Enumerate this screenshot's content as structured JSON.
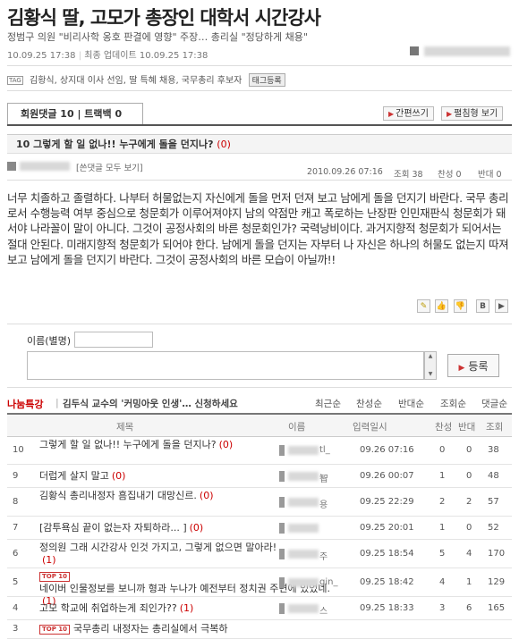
{
  "article": {
    "headline": "김황식 딸, 고모가 총장인 대학서 시간강사",
    "subheadline": "정범구 의원 \"비리사학 옹호 판결에 영향\" 주장… 총리실 \"정당하게 채용\"",
    "published": "10.09.25 17:38",
    "update_label": "최종 업데이트",
    "updated": "10.09.25 17:38",
    "tag_icon": "TAG",
    "tags": "김황식, 상지대 이사 선임, 딸 특혜 채용, 국무총리 후보자",
    "tag_button": "태그등록"
  },
  "comments": {
    "tab_label": "회원댓글 10 | 트랙백 0",
    "write_button": "간편쓰기",
    "expand_button": "펼침형 보기",
    "post": {
      "title": "10 그렇게 할 일 없나!! 누구에게 돌을 던지나?",
      "count": "(0)",
      "view_all": "[쓴댓글 모두 보기]",
      "date": "2010.09.26 07:16",
      "views": "조회 38",
      "agree": "찬성 0",
      "disagree": "반대 0",
      "body": "너무 치졸하고 졸렬하다. 나부터 허물없는지 자신에게 돌을 먼저 던져 보고 남에게 돌을 던지기 바란다. 국무 총리로서 수행능력 여부 중심으로 청문회가 이루어져야지 남의 약점만 캐고 폭로하는 난장판 인민재판식 청문회가 돼서야 나라꼴이 말이 아니다. 그것이 공정사회의 바른 청문회인가? 국력낭비이다. 과거지향적 청문회가 되어서는 절대 안된다. 미래지향적 청문회가 되어야 한다. 남에게 돌을 던지는 자부터 나 자신은 하나의 허물도 없는지 따져보고 남에게 돌을 던지기 바란다. 그것이 공정사회의 바른 모습이 아닐까!!"
    },
    "form": {
      "name_label": "이름(별명)",
      "submit_label": "등록"
    },
    "list": {
      "promo_label": "나눔특강",
      "promo_text": "김두식 교수의 '커밍아웃 인생'… 신청하세요",
      "sort_options": [
        "최근순",
        "찬성순",
        "반대순",
        "조회순",
        "댓글순"
      ],
      "columns": [
        "제목",
        "이름",
        "입력일시",
        "찬성",
        "반대",
        "조회"
      ],
      "rows": [
        {
          "num": "10",
          "title": "그렇게 할 일 없나!! 누구에게 돌을 던지나?",
          "count": "(0)",
          "name": "tl_",
          "date": "09.26 07:16",
          "agree": "0",
          "disagree": "0",
          "views": "38",
          "badge": ""
        },
        {
          "num": "9",
          "title": "더럽게 살지 말고",
          "count": "(0)",
          "name": "智",
          "date": "09.26 00:07",
          "agree": "1",
          "disagree": "0",
          "views": "48",
          "badge": ""
        },
        {
          "num": "8",
          "title": "김황식 총리내정자 흠집내기 대망신르.",
          "count": "(0)",
          "name": "용",
          "date": "09.25 22:29",
          "agree": "2",
          "disagree": "2",
          "views": "57",
          "badge": ""
        },
        {
          "num": "7",
          "title": "[감투욕심 끝이 없는자 자퇴하라... ]",
          "count": "(0)",
          "name": "",
          "date": "09.25 20:01",
          "agree": "1",
          "disagree": "0",
          "views": "52",
          "badge": ""
        },
        {
          "num": "6",
          "title": "정의원 그래 시간강사 인것 가지고, 그렇게 없으면 말아라!",
          "count": "(1)",
          "name": "주",
          "date": "09.25 18:54",
          "agree": "5",
          "disagree": "4",
          "views": "170",
          "badge": ""
        },
        {
          "num": "5",
          "title": "네이버 인물정보를 보니까 형과 누나가 예전부터 정치권 주변에 있었네.",
          "count": "(1)",
          "name": "gin_",
          "date": "09.25 18:42",
          "agree": "4",
          "disagree": "1",
          "views": "129",
          "badge": "TOP 10"
        },
        {
          "num": "4",
          "title": "고모 학교에 취업하는게 죄인가??",
          "count": "(1)",
          "name": "스",
          "date": "09.25 18:33",
          "agree": "3",
          "disagree": "6",
          "views": "165",
          "badge": ""
        },
        {
          "num": "3",
          "title": "국무총리 내정자는 총리실에서 극복하",
          "count": "",
          "name": "",
          "date": "",
          "agree": "",
          "disagree": "",
          "views": "",
          "badge": "TOP 10"
        }
      ]
    }
  }
}
